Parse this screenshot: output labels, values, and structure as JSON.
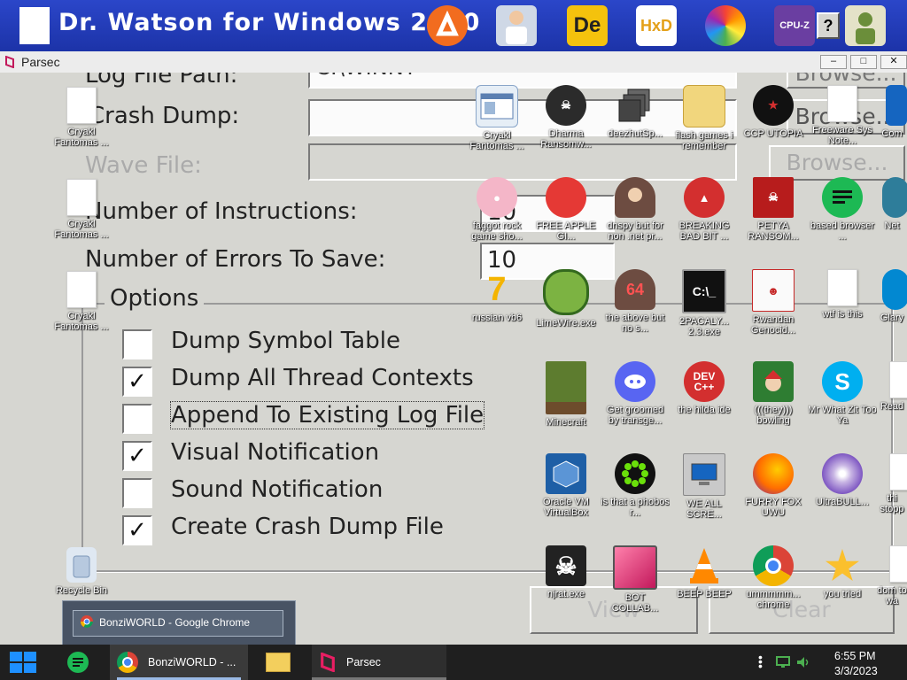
{
  "top_window": {
    "title": "Dr. Watson for Windows 2000"
  },
  "parsec_window": {
    "title": "Parsec",
    "controls": [
      "minimize",
      "maximize",
      "close"
    ]
  },
  "dialog": {
    "log_file_path_label": "Log File Path:",
    "log_file_path_value": "C:\\WINNT",
    "crash_dump_label": "Crash Dump:",
    "wave_file_label": "Wave File:",
    "instructions_label": "Number of Instructions:",
    "instructions_value": "10",
    "errors_label": "Number of Errors To Save:",
    "errors_value": "10",
    "options_title": "Options",
    "browse_label": "Browse...",
    "view_label": "View",
    "clear_label": "Clear",
    "options": [
      {
        "label": "Dump Symbol Table",
        "checked": false
      },
      {
        "label": "Dump All Thread Contexts",
        "checked": true
      },
      {
        "label": "Append To Existing Log File",
        "checked": false
      },
      {
        "label": "Visual Notification",
        "checked": true
      },
      {
        "label": "Sound Notification",
        "checked": false
      },
      {
        "label": "Create Crash Dump File",
        "checked": true
      }
    ]
  },
  "desktop_icons": {
    "left": [
      {
        "label": "Cryakl Fantomas ...",
        "icon": "file-icon"
      },
      {
        "label": "Cryakl Fantomas ...",
        "icon": "file-icon"
      },
      {
        "label": "Cryakl Fantomas ...",
        "icon": "file-icon"
      },
      {
        "label": "Recycle Bin",
        "icon": "recycle-bin-icon"
      }
    ],
    "grid": [
      {
        "label": "Cryakl Fantomas ...",
        "icon": "window-icon"
      },
      {
        "label": "Dharma Ransomw...",
        "icon": "skull-icon"
      },
      {
        "label": "deezhutSp...",
        "icon": "stack-icon"
      },
      {
        "label": "flash games i remember",
        "icon": "folder-icon"
      },
      {
        "label": "CCP UTOPIA",
        "icon": "ccp-icon"
      },
      {
        "label": "Freeware Sys Note...",
        "icon": "file-icon"
      },
      {
        "label": "Com",
        "icon": "blue-icon"
      },
      {
        "label": "faggot rock game sho...",
        "icon": "pig-icon"
      },
      {
        "label": "FREE APPLE GI...",
        "icon": "apple-icon"
      },
      {
        "label": "dnspy but for non .net pr...",
        "icon": "portrait-icon"
      },
      {
        "label": "BREAKING BAD BIT ...",
        "icon": "angry-bird-icon"
      },
      {
        "label": "PETYA RANSOM...",
        "icon": "petya-icon"
      },
      {
        "label": "based browser ...",
        "icon": "green-doc-icon"
      },
      {
        "label": "Net",
        "icon": "globe-icon"
      },
      {
        "label": "russian vb6",
        "icon": "vb6-icon"
      },
      {
        "label": "LimeWire.exe",
        "icon": "limewire-icon"
      },
      {
        "label": "the above but no s...",
        "icon": "portrait-64-icon"
      },
      {
        "label": "2PACALY... 2.3.exe",
        "icon": "cmd-icon"
      },
      {
        "label": "Rwandan Genocid...",
        "icon": "meme-icon"
      },
      {
        "label": "wtf is this",
        "icon": "file-icon"
      },
      {
        "label": "Glary",
        "icon": "glary-icon"
      },
      {
        "label": "Minecraft",
        "icon": "minecraft-icon"
      },
      {
        "label": "Get groomed by transge...",
        "icon": "discord-icon"
      },
      {
        "label": "the hilda ide",
        "icon": "devcpp-icon"
      },
      {
        "label": "(((they))) bowling",
        "icon": "santa-icon"
      },
      {
        "label": "Mr What Zit Too Ya",
        "icon": "skype-icon"
      },
      {
        "label": "Read",
        "icon": "file-icon"
      },
      {
        "label": "Oracle VM VirtualBox",
        "icon": "virtualbox-icon"
      },
      {
        "label": "is that a phobos r...",
        "icon": "icq-icon"
      },
      {
        "label": "WE ALL SCRE...",
        "icon": "computer-icon"
      },
      {
        "label": "FURRY FOX UWU",
        "icon": "firefox-icon"
      },
      {
        "label": "UltraBULL...",
        "icon": "disc-icon"
      },
      {
        "label": "thi stopp",
        "icon": "file-icon"
      },
      {
        "label": "njrat.exe",
        "icon": "skull-icon"
      },
      {
        "label": "BOT COLLAB...",
        "icon": "monitor-icon"
      },
      {
        "label": "BEEP BEEP",
        "icon": "vlc-icon"
      },
      {
        "label": "ummmmm... chrome",
        "icon": "chrome-icon"
      },
      {
        "label": "you tried",
        "icon": "star-icon"
      },
      {
        "label": "dom to wa",
        "icon": "file-icon"
      }
    ]
  },
  "hover_preview": {
    "title": "BonziWORLD - Google Chrome"
  },
  "taskbar": {
    "apps": [
      {
        "label": "",
        "icon": "windows-start-icon"
      },
      {
        "label": "",
        "icon": "green-doc-icon"
      },
      {
        "label": "BonziWORLD - ...",
        "icon": "chrome-icon"
      },
      {
        "label": "",
        "icon": "folder-icon"
      },
      {
        "label": "Parsec",
        "icon": "parsec-icon"
      }
    ],
    "time": "6:55 PM",
    "date": "3/3/2023"
  },
  "colors": {
    "titlebar_blue": "#1c33a8",
    "dialog_gray": "#d6d6d1",
    "taskbar": "#1f1f1f",
    "parsec_accent": "#c2185b"
  }
}
